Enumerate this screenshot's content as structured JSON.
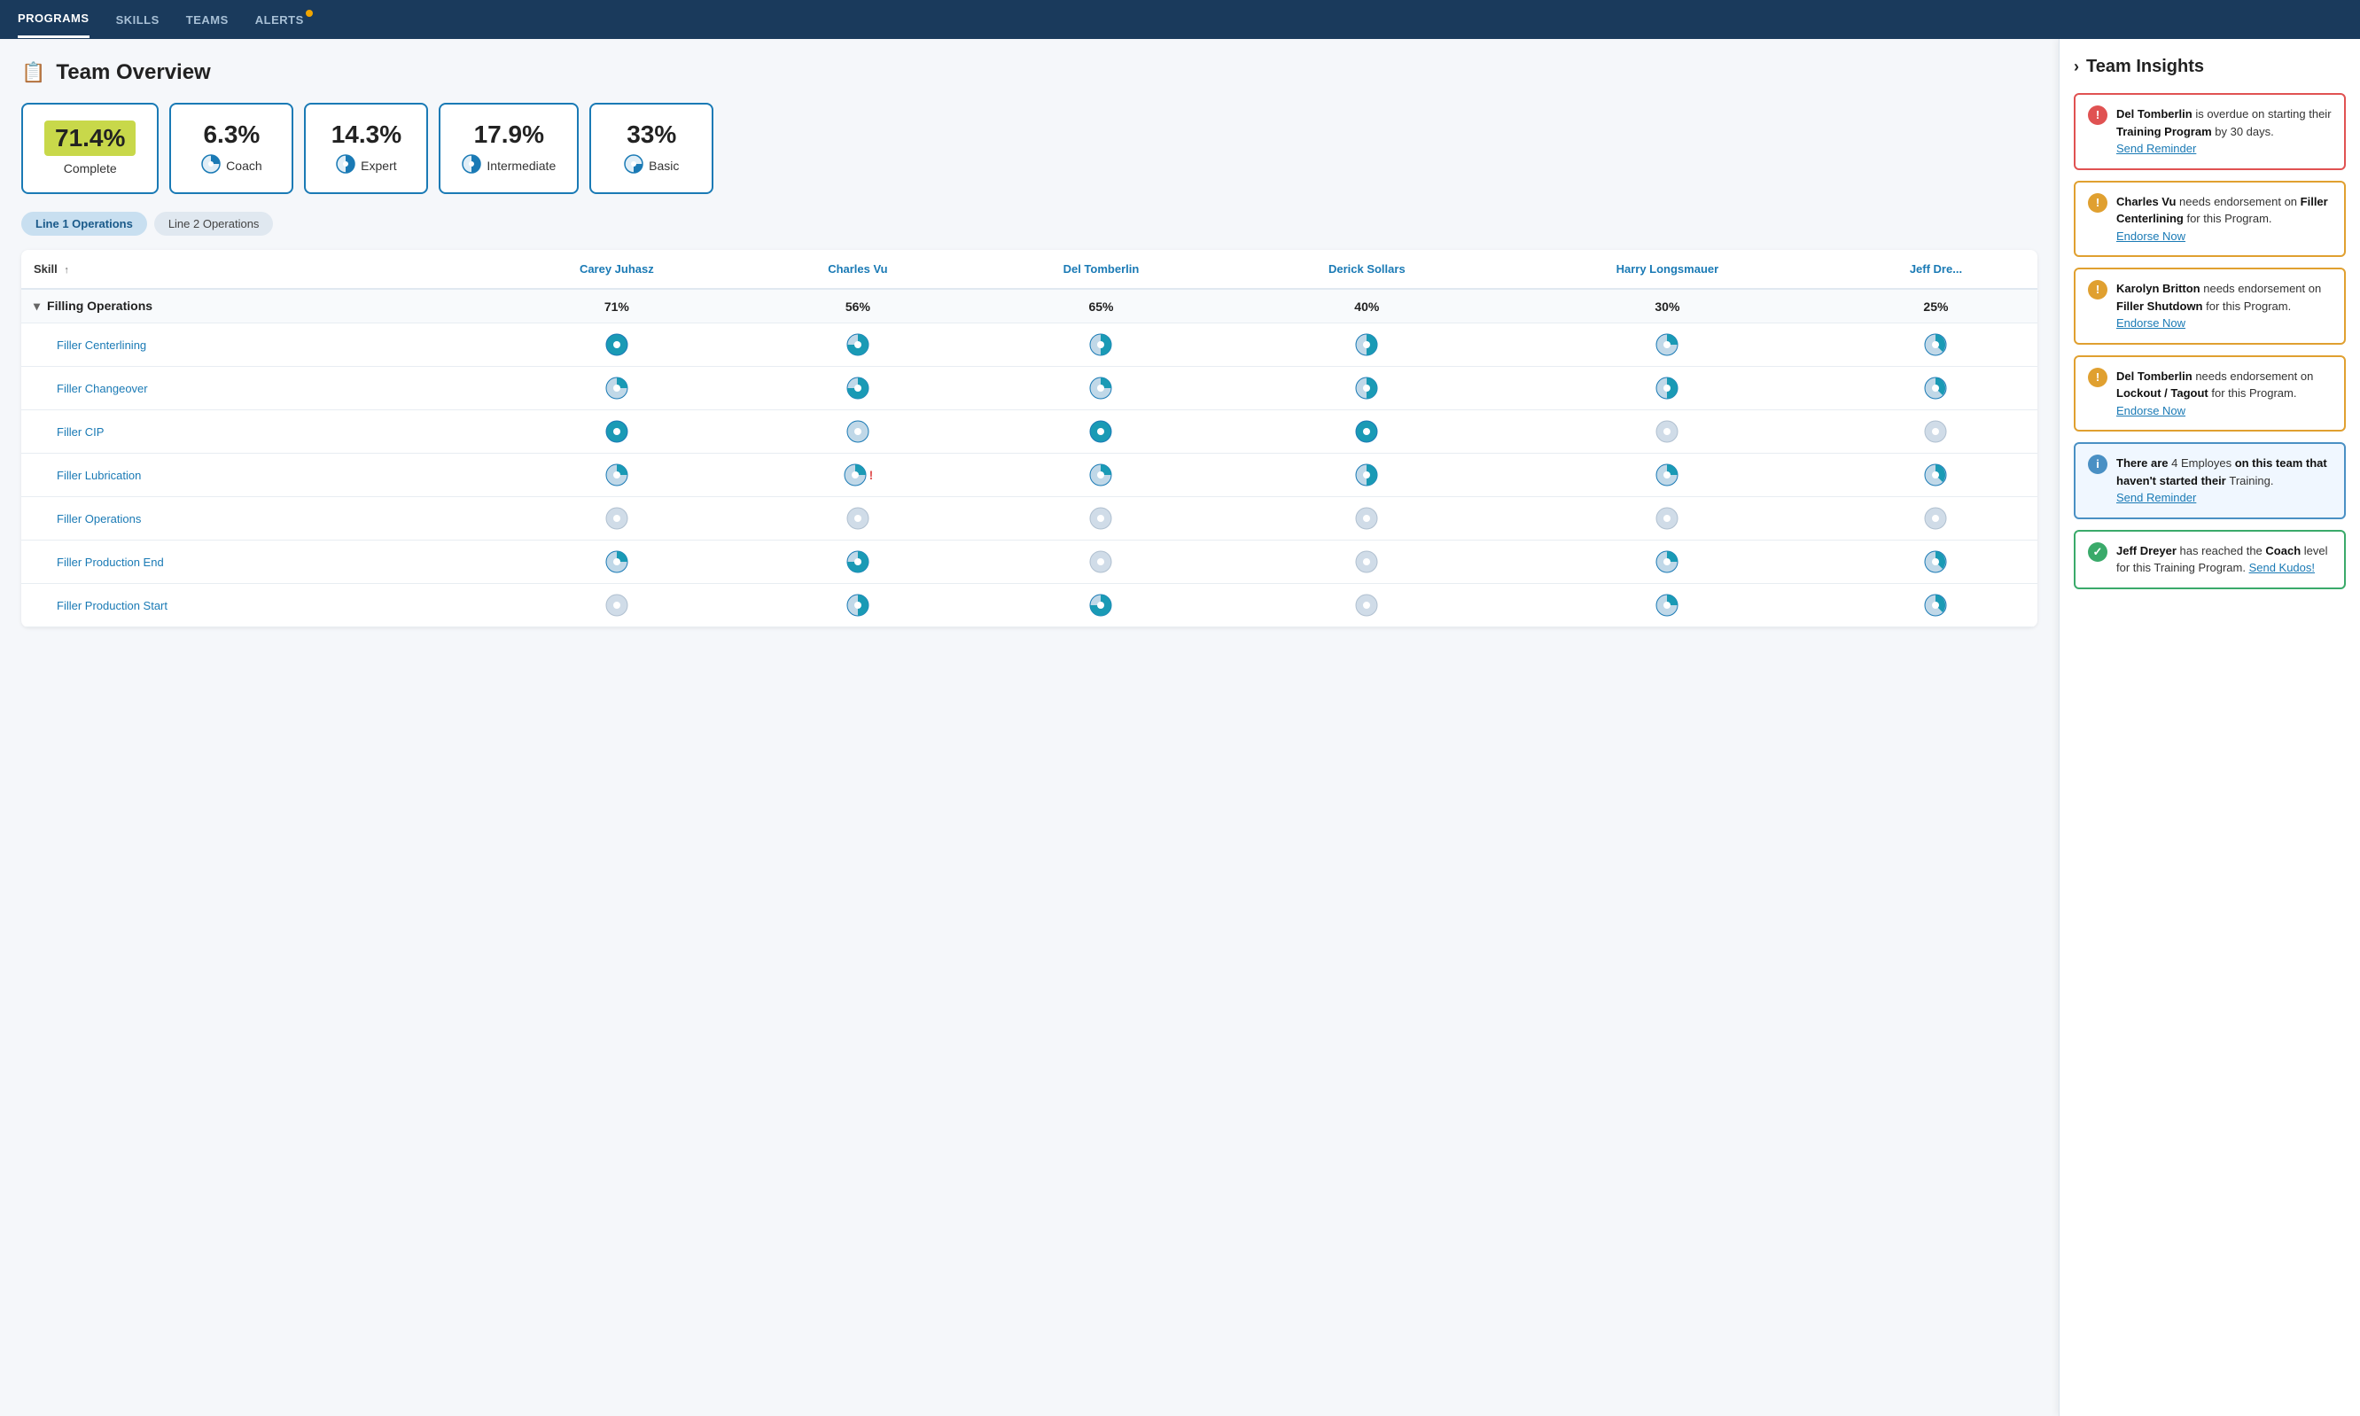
{
  "nav": {
    "items": [
      {
        "label": "PROGRAMS",
        "active": true
      },
      {
        "label": "SKILLS",
        "active": false
      },
      {
        "label": "TEAMS",
        "active": false
      },
      {
        "label": "ALERTS",
        "active": false,
        "dot": true
      }
    ]
  },
  "page": {
    "title": "Team Overview",
    "title_icon": "📋"
  },
  "metrics": [
    {
      "value": "71.4%",
      "label": "Complete",
      "type": "complete",
      "icon": "complete"
    },
    {
      "value": "6.3%",
      "label": "Coach",
      "icon": "coach"
    },
    {
      "value": "14.3%",
      "label": "Expert",
      "icon": "expert"
    },
    {
      "value": "17.9%",
      "label": "Intermediate",
      "icon": "intermediate"
    },
    {
      "value": "33%",
      "label": "Basic",
      "icon": "basic"
    }
  ],
  "tabs": [
    {
      "label": "Line 1 Operations",
      "active": true
    },
    {
      "label": "Line 2 Operations",
      "active": false
    }
  ],
  "table": {
    "skill_col_header": "Skill",
    "sort_indicator": "↑",
    "columns": [
      {
        "name": "Carey Juhasz"
      },
      {
        "name": "Charles Vu"
      },
      {
        "name": "Del Tomberlin"
      },
      {
        "name": "Derick Sollars"
      },
      {
        "name": "Harry Longsmauer"
      },
      {
        "name": "Jeff Dre..."
      }
    ],
    "sections": [
      {
        "name": "Filling Operations",
        "percentages": [
          "71%",
          "56%",
          "65%",
          "40%",
          "30%",
          "25%"
        ],
        "skills": [
          {
            "name": "Filler Centerlining",
            "cells": [
              "full",
              "half-more",
              "half",
              "half",
              "quarter",
              "partial"
            ]
          },
          {
            "name": "Filler Changeover",
            "cells": [
              "quarter",
              "half-more",
              "quarter",
              "half",
              "half",
              "partial"
            ]
          },
          {
            "name": "Filler CIP",
            "cells": [
              "full",
              "empty-teal",
              "full",
              "full",
              "empty",
              "empty"
            ]
          },
          {
            "name": "Filler Lubrication",
            "cells": [
              "quarter-small",
              "quarter-exclaim",
              "quarter-small",
              "half",
              "quarter-small",
              "partial"
            ]
          },
          {
            "name": "Filler Operations",
            "cells": [
              "empty",
              "empty",
              "empty",
              "empty",
              "empty",
              "empty"
            ]
          },
          {
            "name": "Filler Production End",
            "cells": [
              "quarter-small",
              "half-more",
              "empty",
              "empty",
              "quarter-small",
              "partial"
            ]
          },
          {
            "name": "Filler Production Start",
            "cells": [
              "empty",
              "half-small",
              "half-more",
              "empty",
              "quarter-small",
              "partial"
            ]
          }
        ]
      }
    ]
  },
  "sidebar": {
    "title": "Team Insights",
    "insights": [
      {
        "type": "red",
        "icon": "!",
        "text_parts": [
          "Del Tomberlin",
          " is overdue on starting their ",
          "Training Program",
          " by 30 days. "
        ],
        "link": "Send Reminder"
      },
      {
        "type": "yellow",
        "icon": "!",
        "text_parts": [
          "Charles Vu",
          " needs endorsement on ",
          "Filler Centerlining",
          " for this Program. "
        ],
        "link": "Endorse Now"
      },
      {
        "type": "yellow",
        "icon": "!",
        "text_parts": [
          "Karolyn Britton",
          " needs endorsement on ",
          "Filler Shutdown",
          " for this Program. "
        ],
        "link": "Endorse Now"
      },
      {
        "type": "yellow",
        "icon": "!",
        "text_parts": [
          "Del Tomberlin",
          " needs endorsement on ",
          "Lockout / Tagout",
          " for this Program. "
        ],
        "link": "Endorse Now"
      },
      {
        "type": "blue",
        "icon": "i",
        "text_parts": [
          "There are ",
          "4 Employes",
          " on this team that haven't started their ",
          "Training. "
        ],
        "link": "Send Reminder"
      },
      {
        "type": "green",
        "icon": "✓",
        "text_parts": [
          "Jeff Dreyer",
          " has reached the ",
          "Coach",
          " level for this Training Program. "
        ],
        "link": "Send Kudos!"
      }
    ]
  }
}
